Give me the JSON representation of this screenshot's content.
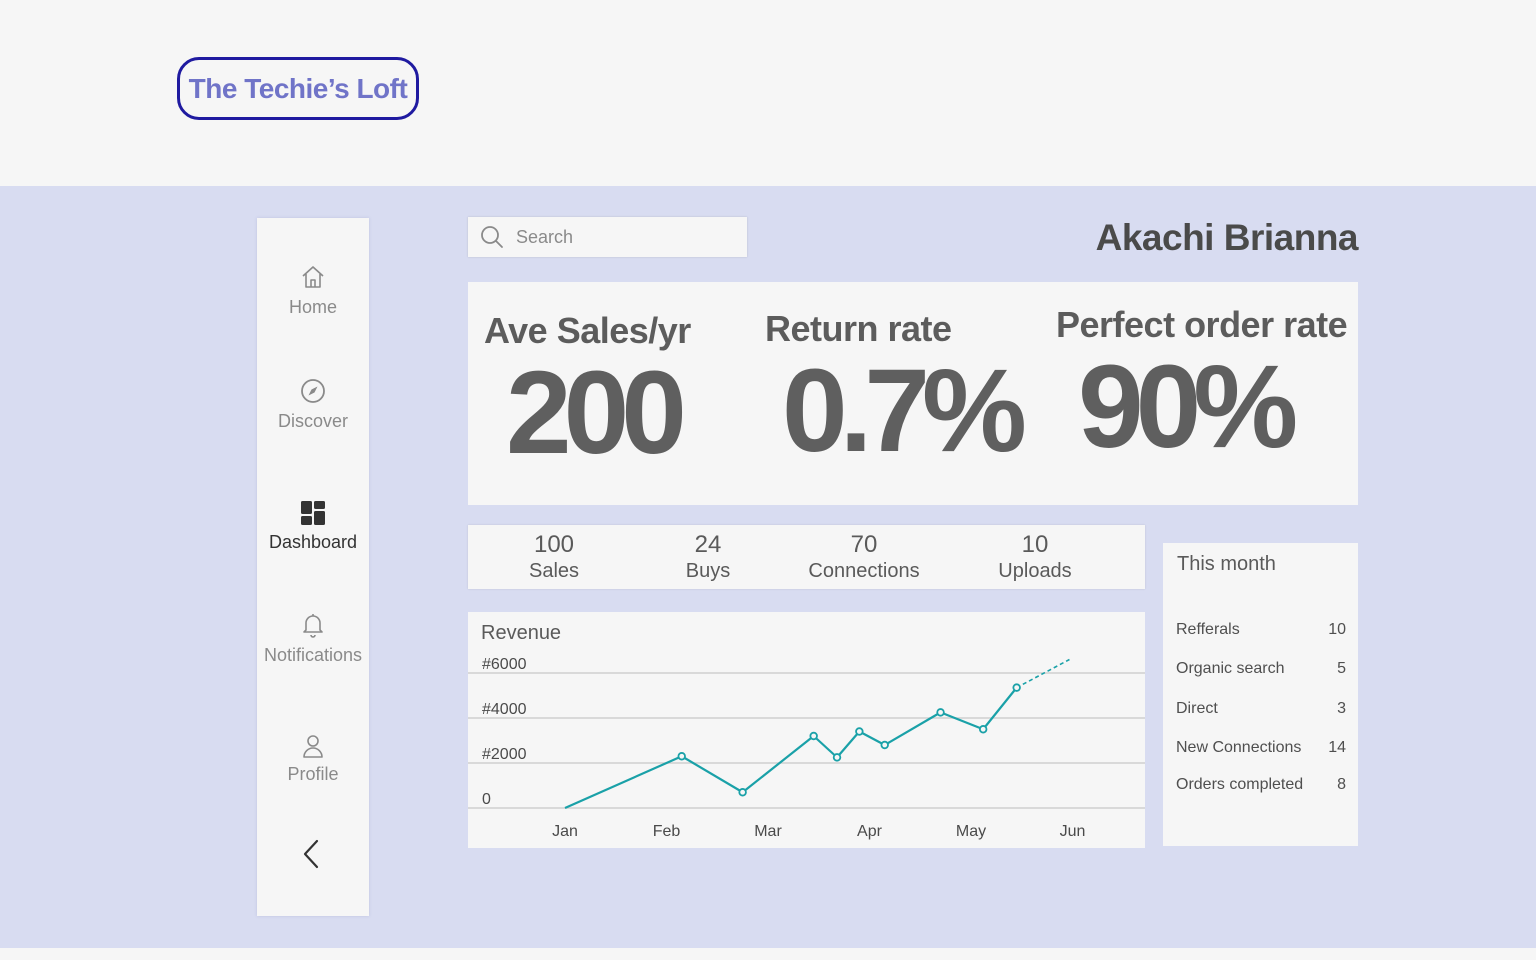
{
  "brand": {
    "logo_text": "The Techie’s Loft",
    "accent": "#1f1aa0"
  },
  "sidebar": {
    "items": [
      {
        "label": "Home",
        "icon": "home-icon",
        "active": false
      },
      {
        "label": "Discover",
        "icon": "compass-icon",
        "active": false
      },
      {
        "label": "Dashboard",
        "icon": "dashboard-grid-icon",
        "active": true
      },
      {
        "label": "Notifications",
        "icon": "bell-icon",
        "active": false
      },
      {
        "label": "Profile",
        "icon": "user-icon",
        "active": false
      }
    ],
    "collapse_icon": "chevron-left-icon"
  },
  "search": {
    "placeholder": "Search",
    "value": ""
  },
  "user": {
    "name": "Akachi Brianna"
  },
  "kpis": [
    {
      "title": "Ave Sales/yr",
      "value": "200"
    },
    {
      "title": "Return rate",
      "value": "0.7%"
    },
    {
      "title": "Perfect order rate",
      "value": "90%"
    }
  ],
  "counts": [
    {
      "value": "100",
      "label": "Sales"
    },
    {
      "value": "24",
      "label": "Buys"
    },
    {
      "value": "70",
      "label": "Connections"
    },
    {
      "value": "10",
      "label": "Uploads"
    }
  ],
  "this_month": {
    "title": "This month",
    "rows": [
      {
        "label": "Refferals",
        "value": "10"
      },
      {
        "label": "Organic search",
        "value": "5"
      },
      {
        "label": "Direct",
        "value": "3"
      },
      {
        "label": "New Connections",
        "value": "14"
      },
      {
        "label": "Orders completed",
        "value": "8"
      }
    ]
  },
  "chart_data": {
    "type": "line",
    "title": "Revenue",
    "categories": [
      "Jan",
      "Feb",
      "Mar",
      "Apr",
      "May",
      "Jun"
    ],
    "yticks": [
      "0",
      "#2000",
      "#4000",
      "#6000"
    ],
    "ytick_values": [
      0,
      2000,
      4000,
      6000
    ],
    "ylim": [
      0,
      6000
    ],
    "color": "#1aa1a8",
    "grid": true,
    "series": [
      {
        "points": [
          {
            "x": 0.0,
            "y": 0
          },
          {
            "x": 1.15,
            "y": 2300
          },
          {
            "x": 1.75,
            "y": 700
          },
          {
            "x": 2.45,
            "y": 3200
          },
          {
            "x": 2.68,
            "y": 2250
          },
          {
            "x": 2.9,
            "y": 3400
          },
          {
            "x": 3.15,
            "y": 2800
          },
          {
            "x": 3.7,
            "y": 4250
          },
          {
            "x": 4.12,
            "y": 3500
          },
          {
            "x": 4.45,
            "y": 5350
          }
        ],
        "projection": {
          "x": 4.97,
          "y": 6600
        }
      }
    ]
  }
}
